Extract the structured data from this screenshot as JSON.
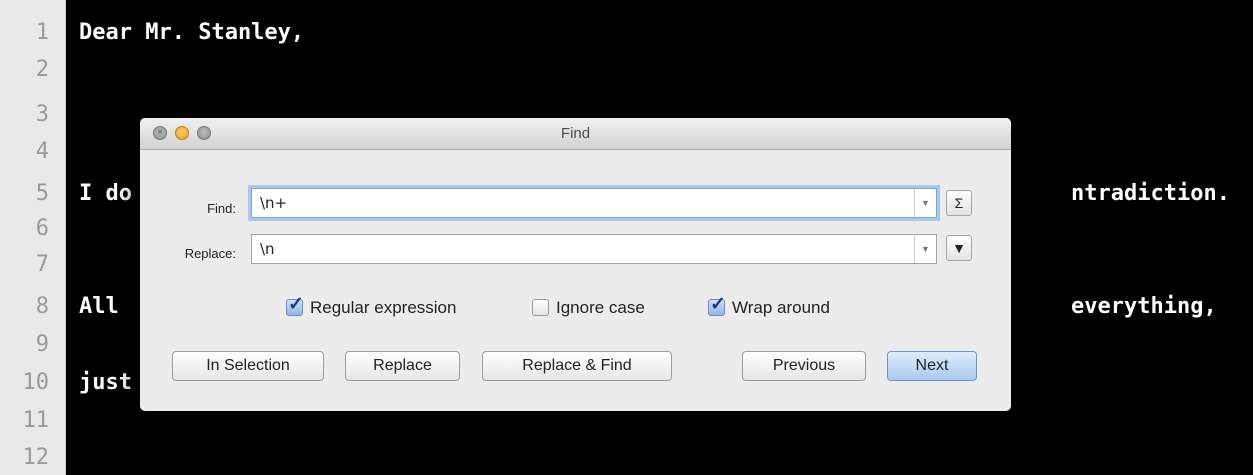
{
  "editor": {
    "line_numbers": [
      "1",
      "2",
      "3",
      "4",
      "5",
      "6",
      "7",
      "8",
      "9",
      "10",
      "11",
      "12"
    ],
    "lines": {
      "l1": "Dear Mr. Stanley,",
      "l5_left": "I do",
      "l5_right": "ntradiction.",
      "l8_left": "All",
      "l8_right": "everything,",
      "l10_left": "just"
    }
  },
  "dialog": {
    "title": "Find",
    "find_label": "Find:",
    "find_value": "\\n+",
    "replace_label": "Replace:",
    "replace_value": "\\n",
    "sigma_button": "Σ",
    "history_button": "▼",
    "options": {
      "regex": "Regular expression",
      "ignore_case": "Ignore case",
      "wrap_around": "Wrap around"
    },
    "option_states": {
      "regex": true,
      "ignore_case": false,
      "wrap_around": true
    },
    "buttons": {
      "in_selection": "In Selection",
      "replace": "Replace",
      "replace_find": "Replace & Find",
      "previous": "Previous",
      "next": "Next"
    }
  }
}
